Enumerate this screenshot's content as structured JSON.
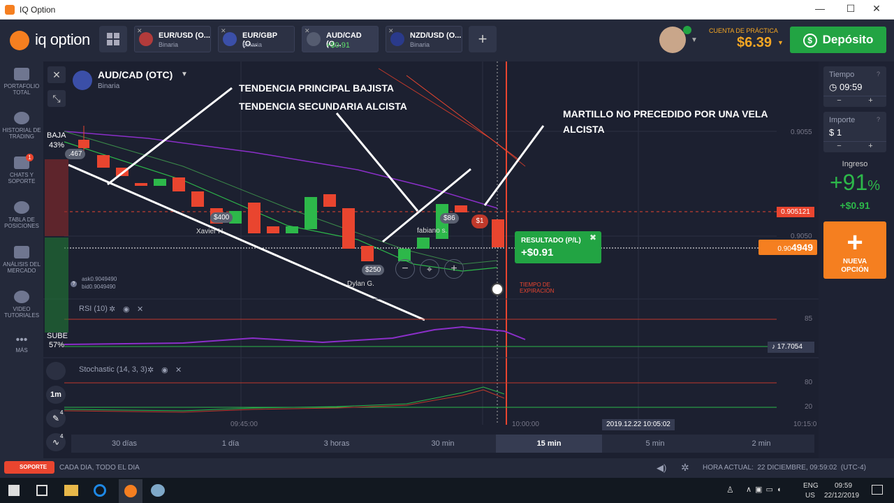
{
  "window": {
    "title": "IQ Option",
    "minimize": "—",
    "maximize": "☐",
    "close": "✕"
  },
  "header": {
    "logo": "iq option",
    "tabs": [
      {
        "name": "EUR/USD (O...",
        "sub": "Binaria"
      },
      {
        "name": "EUR/GBP (O...",
        "sub": "Binaria"
      },
      {
        "name": "AUD/CAD (O...",
        "sub": "+$0.91"
      },
      {
        "name": "NZD/USD (O...",
        "sub": "Binaria"
      }
    ],
    "add_tab": "+",
    "account_label": "CUENTA DE PRÁCTICA",
    "account_value": "$6.39",
    "deposit_label": "Depósito"
  },
  "leftnav": [
    {
      "label": "PORTAFOLIO TOTAL",
      "icon": "briefcase-icon"
    },
    {
      "label": "HISTORIAL DE TRADING",
      "icon": "history-icon"
    },
    {
      "label": "CHATS Y SOPORTE",
      "icon": "chat-icon",
      "badge": "1"
    },
    {
      "label": "TABLA DE POSICIONES",
      "icon": "trophy-icon"
    },
    {
      "label": "ANÁLISIS DEL MERCADO",
      "icon": "news-icon"
    },
    {
      "label": "VIDEO TUTORIALES",
      "icon": "play-icon"
    },
    {
      "label": "MÁS",
      "icon": "more-icon"
    }
  ],
  "asset": {
    "name": "AUD/CAD (OTC)",
    "type": "Binaria"
  },
  "sentiment": {
    "down_label": "BAJA",
    "down_pct": "43%",
    "up_label": "SUBE",
    "up_pct": "57%"
  },
  "annotations": {
    "a1": "TENDENCIA PRINCIPAL BAJISTA",
    "a2": "TENDENCIA SECUNDARIA ALCISTA",
    "a3": "MARTILLO NO PRECEDIDO POR UNA VELA ALCISTA"
  },
  "prices": {
    "p1": "0.9055",
    "p2": "0.905121",
    "p3": "0.9050",
    "current_prefix": "0.90",
    "current_suffix": "4949",
    "ask": "ask0.9049490",
    "bid": "bid0.9049490",
    "left_tag": ".467"
  },
  "traders": [
    {
      "name": "Xavier H.",
      "amount": "$400"
    },
    {
      "name": "Dylan G.",
      "amount": "$250"
    },
    {
      "name": "fabiano s.",
      "amount": "$86"
    }
  ],
  "my_trade": "$1",
  "result": {
    "label": "RESULTADO (P/L)",
    "value": "+$0.91"
  },
  "expiration": "TIEMPO DE EXPIRACIÓN",
  "indicators": {
    "rsi": "RSI (10)",
    "rsi_85": "85",
    "rsi_value": "17.7054",
    "stoch": "Stochastic (14, 3, 3)",
    "stoch_80": "80",
    "stoch_20": "20"
  },
  "time_axis": {
    "t1": "09:45:00",
    "t2": "10:00:00",
    "t3": "10:15:0",
    "cursor": "2019.12.22 10:05:02"
  },
  "timeframe_btn": "1m",
  "tool_badge": "4",
  "periods": [
    "30 días",
    "1 día",
    "3 horas",
    "30 min",
    "15 min",
    "5 min",
    "2 min"
  ],
  "right_panel": {
    "time_label": "Tiempo",
    "time_value": "09:59",
    "amount_label": "Importe",
    "amount_value": "$ 1",
    "minus": "−",
    "plus": "+",
    "income_label": "Ingreso",
    "income_pct": "+91",
    "income_pct_sign": "%",
    "income_value": "+$0.91",
    "new_option": "NUEVA OPCIÓN",
    "new_option_plus": "+"
  },
  "statusbar": {
    "support": "SOPORTE",
    "slogan": "CADA DIA, TODO EL DIA",
    "time": "HORA ACTUAL:  22 DICIEMBRE, 09:59:02  (UTC-4)"
  },
  "taskbar": {
    "lang": "ENG",
    "region": "US",
    "clock": "09:59",
    "date": "22/12/2019"
  },
  "colors": {
    "green": "#22a443",
    "red": "#e9452f",
    "orange": "#f57f20",
    "bg": "#1c2030"
  },
  "chart_data": {
    "type": "candlestick",
    "note_axis": "price",
    "price_ticks": [
      0.9055,
      0.905
    ],
    "current_price": 0.904949
  }
}
